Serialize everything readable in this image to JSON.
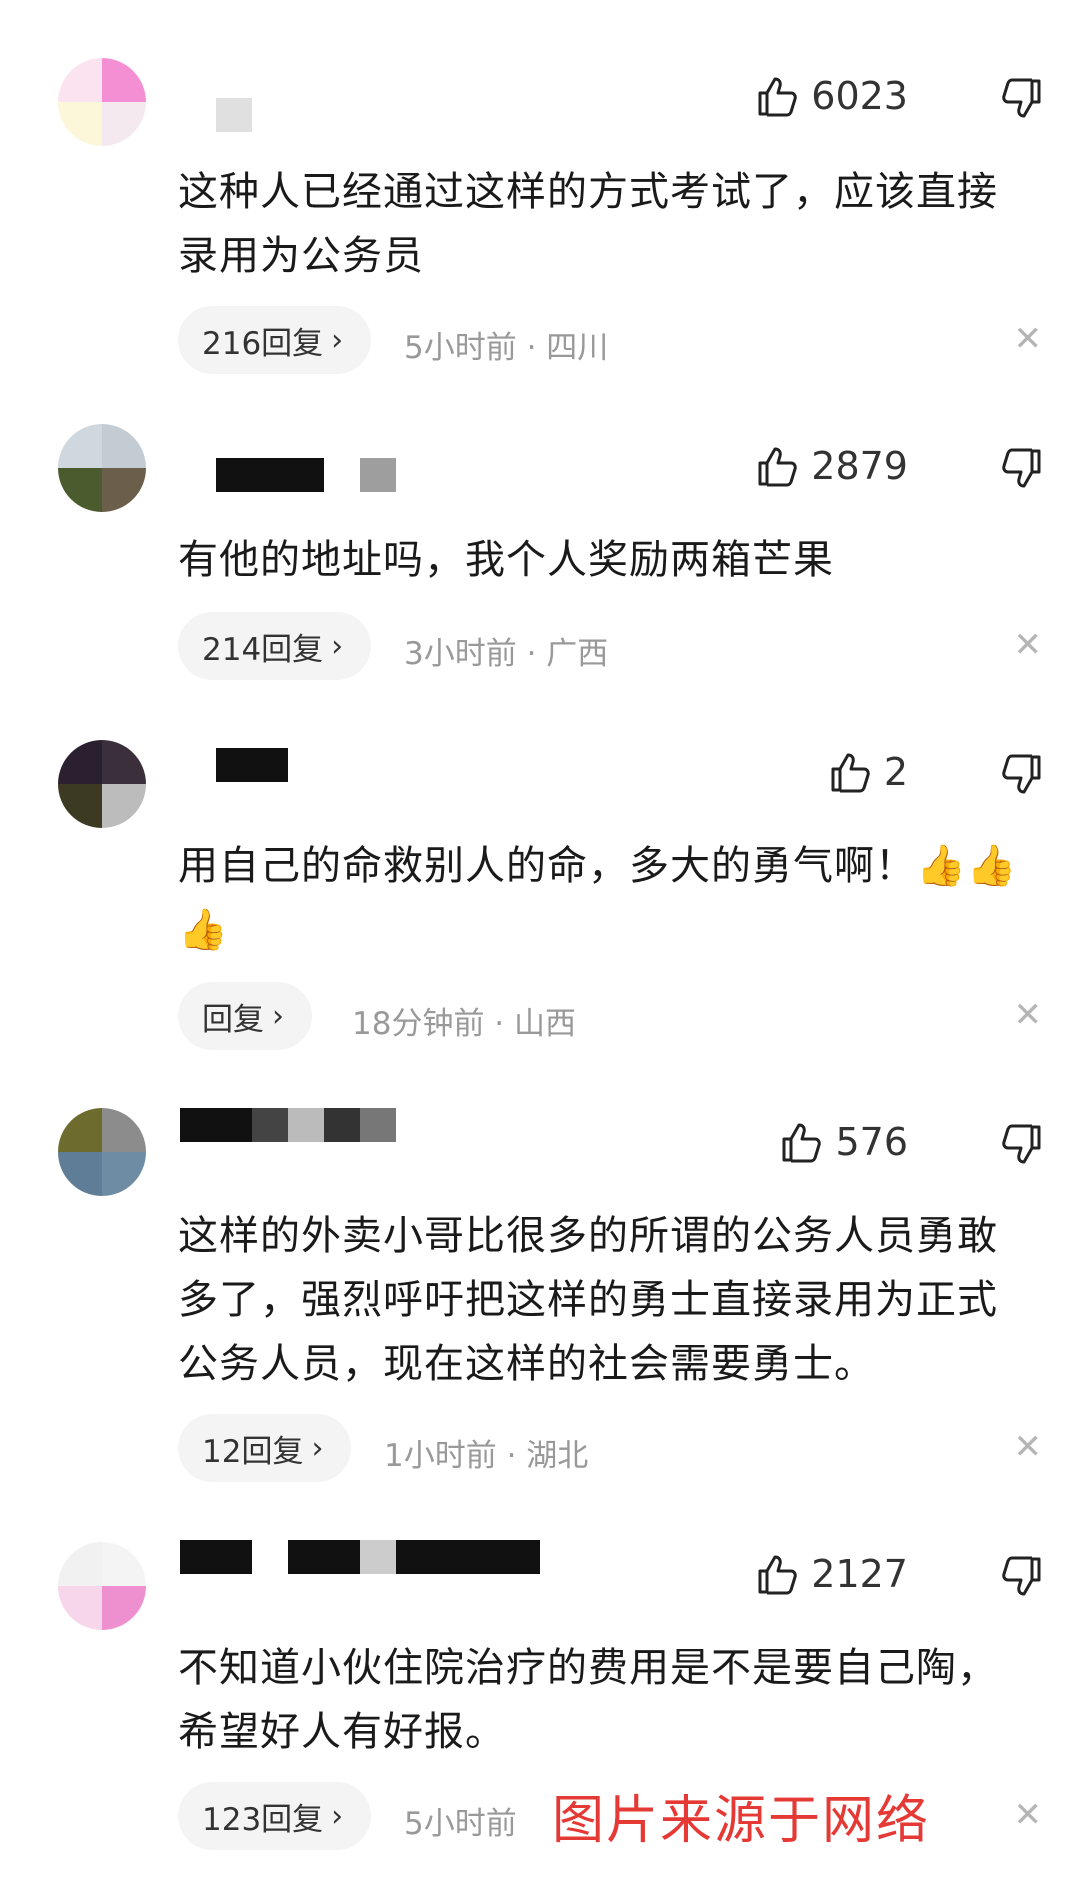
{
  "comments": [
    {
      "likes": "6023",
      "text": "这种人已经通过这样的方式考试了，应该直接录用为公务员",
      "reply": "216回复",
      "meta": "5小时前 · 四川"
    },
    {
      "likes": "2879",
      "text": "有他的地址吗，我个人奖励两箱芒果",
      "reply": "214回复",
      "meta": "3小时前 · 广西"
    },
    {
      "likes": "2",
      "text": "用自己的命救别人的命，多大的勇气啊！👍👍👍",
      "reply": "回复",
      "meta": "18分钟前 · 山西"
    },
    {
      "likes": "576",
      "text": "这样的外卖小哥比很多的所谓的公务人员勇敢多了，强烈呼吁把这样的勇士直接录用为正式公务人员，现在这样的社会需要勇士。",
      "reply": "12回复",
      "meta": "1小时前 · 湖北"
    },
    {
      "likes": "2127",
      "text": "不知道小伙住院治疗的费用是不是要自己陶，希望好人有好报。",
      "reply": "123回复",
      "meta": "5小时前"
    }
  ],
  "watermark": "图片来源于网络",
  "icons": {
    "like": "thumbs-up-icon",
    "dislike": "thumbs-down-icon",
    "close": "close-icon",
    "chevron": "chevron-right-icon"
  }
}
